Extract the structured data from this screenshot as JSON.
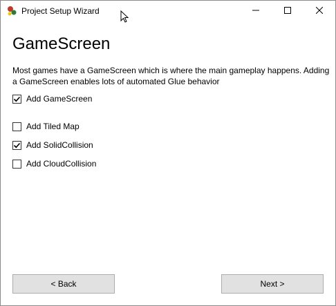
{
  "window": {
    "title": "Project Setup Wizard",
    "app_icon": "frb-logo-icon",
    "controls": {
      "minimize_icon": "minimize-icon",
      "maximize_icon": "maximize-icon",
      "close_icon": "close-icon"
    }
  },
  "page": {
    "heading": "GameScreen",
    "description": "Most games have a GameScreen which is where the main gameplay happens. Adding a GameScreen enables lots of automated Glue behavior"
  },
  "options": [
    {
      "label": "Add GameScreen",
      "checked": true
    },
    {
      "label": "Add Tiled Map",
      "checked": false
    },
    {
      "label": "Add SolidCollision",
      "checked": true
    },
    {
      "label": "Add CloudCollision",
      "checked": false
    }
  ],
  "buttons": {
    "back_label": "< Back",
    "next_label": "Next >"
  },
  "colors": {
    "button_bg": "#e1e1e1",
    "button_border": "#adadad",
    "window_border": "#8a8a8a"
  }
}
